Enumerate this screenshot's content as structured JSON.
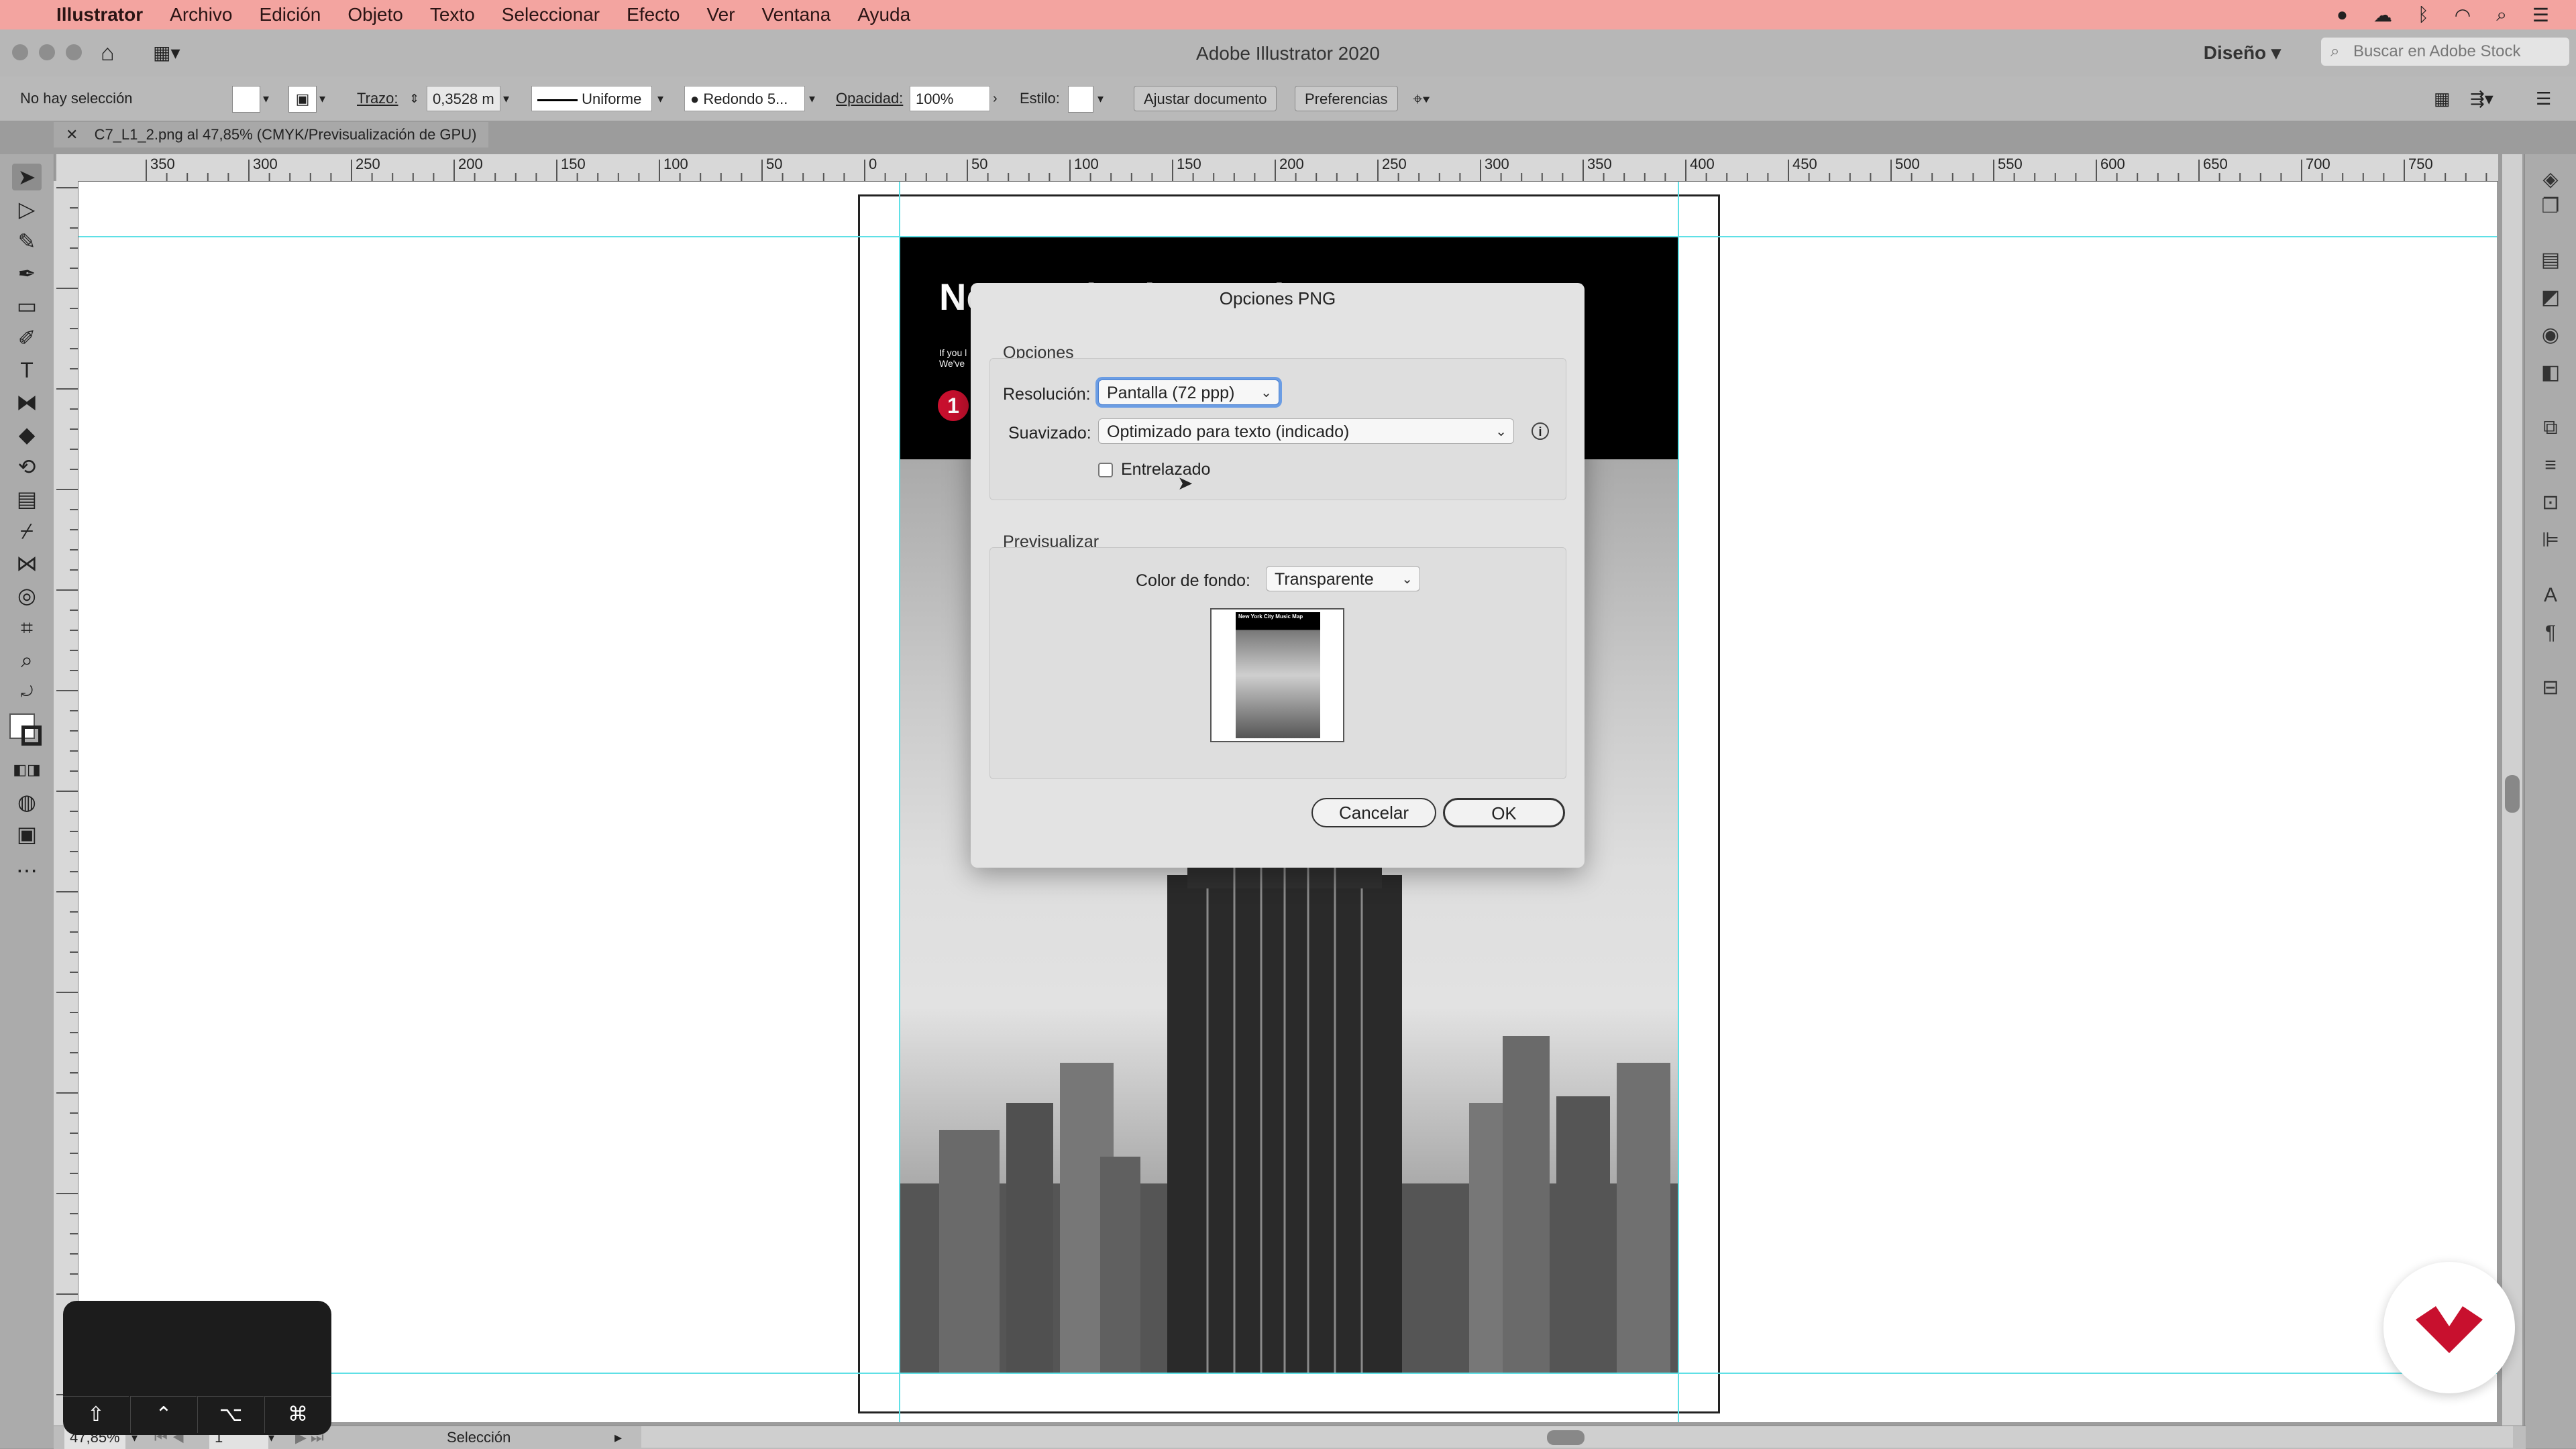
{
  "menubar": {
    "apple_icon": "apple-icon",
    "items": [
      "Illustrator",
      "Archivo",
      "Edición",
      "Objeto",
      "Texto",
      "Seleccionar",
      "Efecto",
      "Ver",
      "Ventana",
      "Ayuda"
    ]
  },
  "window": {
    "title": "Adobe Illustrator 2020",
    "workspace": "Diseño",
    "search_placeholder": "Buscar en Adobe Stock"
  },
  "control_bar": {
    "selection_status": "No hay selección",
    "stroke_label": "Trazo:",
    "stroke_value": "0,3528 m",
    "profile": "Uniforme",
    "brush": "Redondo 5...",
    "opacity_label": "Opacidad:",
    "opacity_value": "100%",
    "style_label": "Estilo:",
    "fit_document": "Ajustar documento",
    "preferences": "Preferencias"
  },
  "document_tab": {
    "name": "C7_L1_2.png al 47,85% (CMYK/Previsualización de GPU)"
  },
  "ruler": {
    "ticks": [
      "350",
      "300",
      "250",
      "200",
      "150",
      "100",
      "50",
      "0",
      "50",
      "100",
      "150",
      "200",
      "250",
      "300",
      "350",
      "400",
      "450",
      "500",
      "550",
      "600",
      "650",
      "700",
      "750"
    ]
  },
  "document": {
    "headline": "New York City Music Map",
    "subtext_line1": "If you l",
    "subtext_line2": "We've",
    "badge": "1"
  },
  "dialog": {
    "title": "Opciones PNG",
    "options_section": "Opciones",
    "resolution_label": "Resolución:",
    "resolution_value": "Pantalla (72 ppp)",
    "antialias_label": "Suavizado:",
    "antialias_value": "Optimizado para texto (indicado)",
    "interlaced_label": "Entrelazado",
    "interlaced_checked": false,
    "preview_section": "Previsualizar",
    "background_label": "Color de fondo:",
    "background_value": "Transparente",
    "thumbnail_text": "New York City Music Map",
    "cancel": "Cancelar",
    "ok": "OK"
  },
  "status_bar": {
    "zoom": "47,85%",
    "artboard": "1",
    "tool": "Selección"
  },
  "keystrokes": [
    "⇧",
    "⌃",
    "⌥",
    "⌘"
  ],
  "colors": {
    "menubar": "#f3a4a0",
    "guide": "#5fe0e6",
    "badge": "#c8102e",
    "logo": "#c8102e"
  }
}
